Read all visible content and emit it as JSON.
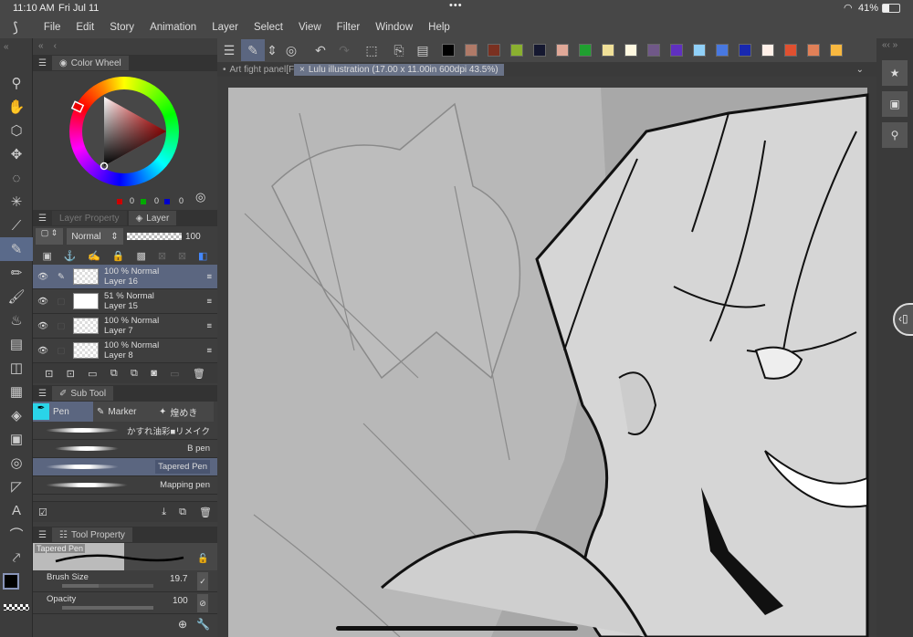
{
  "status": {
    "time": "11:10 AM",
    "date": "Fri Jul 11",
    "battery": "41%",
    "wifi_icon": "wifi-icon"
  },
  "menu": [
    "File",
    "Edit",
    "Story",
    "Animation",
    "Layer",
    "Select",
    "View",
    "Filter",
    "Window",
    "Help"
  ],
  "palette": [
    "#000000",
    "#b07a68",
    "#7a3020",
    "#8ab030",
    "#151830",
    "#e0a898",
    "#20a030",
    "#f0e098",
    "#fff8e0",
    "#705888",
    "#6030c0",
    "#90d0f8",
    "#4878e0",
    "#1828b0",
    "#fff0e8",
    "#e05030",
    "#e08058",
    "#f8b840"
  ],
  "tabs": [
    {
      "label": "Art fight panel[F"
    },
    {
      "label": "Lulu illustration (17.00 x 11.00in 600dpi 43.5%)",
      "active": true
    }
  ],
  "color_wheel": {
    "title": "Color Wheel",
    "r": "0",
    "g": "0",
    "b": "0",
    "main_color": "#000000",
    "sub_color": "#5a2010"
  },
  "layer_panel": {
    "tab_property": "Layer Property",
    "tab_layer": "Layer",
    "blend": "Normal",
    "opacity": "100",
    "layers": [
      {
        "opacity_mode": "100 % Normal",
        "name": "Layer 16",
        "selected": true
      },
      {
        "opacity_mode": "51 % Normal",
        "name": "Layer 15"
      },
      {
        "opacity_mode": "100 % Normal",
        "name": "Layer 7"
      },
      {
        "opacity_mode": "100 % Normal",
        "name": "Layer 8"
      }
    ]
  },
  "sub_tool": {
    "title": "Sub Tool",
    "groups": [
      "Pen",
      "Marker",
      "煌めき"
    ],
    "items": [
      "かすれ油彩■リメイク",
      "B pen",
      "Tapered Pen",
      "Mapping pen"
    ],
    "selected": "Tapered Pen"
  },
  "tool_property": {
    "title": "Tool Property",
    "preview_label": "Tapered Pen",
    "brush_size_label": "Brush Size",
    "brush_size": "19.7",
    "brush_size_fraction": 0.4,
    "opacity_label": "Opacity",
    "opacity": "100",
    "opacity_fraction": 1.0
  }
}
